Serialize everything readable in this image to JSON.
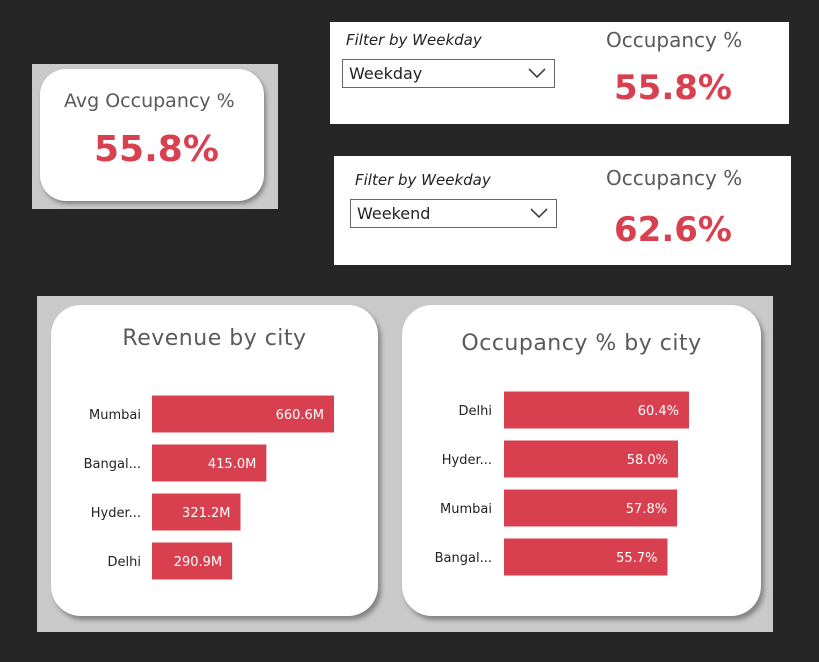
{
  "avg_card": {
    "title": "Avg Occupancy %",
    "value": "55.8%"
  },
  "filters": [
    {
      "label": "Filter by Weekday",
      "selected": "Weekday",
      "kpi_title": "Occupancy %",
      "kpi_value": "55.8%"
    },
    {
      "label": "Filter by Weekday",
      "selected": "Weekend",
      "kpi_title": "Occupancy %",
      "kpi_value": "62.6%"
    }
  ],
  "colors": {
    "bar": "#d9404f",
    "kpi": "#d9404f"
  },
  "chart_data": [
    {
      "type": "bar",
      "orientation": "horizontal",
      "title": "Revenue by city",
      "categories": [
        "Mumbai",
        "Bangal...",
        "Hyder...",
        "Delhi"
      ],
      "values": [
        660.6,
        415.0,
        321.2,
        290.9
      ],
      "labels": [
        "660.6M",
        "415.0M",
        "321.2M",
        "290.9M"
      ],
      "unit": "M",
      "grid": false,
      "legend": "none"
    },
    {
      "type": "bar",
      "orientation": "horizontal",
      "title": "Occupancy % by city",
      "categories": [
        "Delhi",
        "Hyder...",
        "Mumbai",
        "Bangal..."
      ],
      "values": [
        60.4,
        58.0,
        57.8,
        55.7
      ],
      "labels": [
        "60.4%",
        "58.0%",
        "57.8%",
        "55.7%"
      ],
      "unit": "%",
      "grid": false,
      "legend": "none"
    }
  ]
}
